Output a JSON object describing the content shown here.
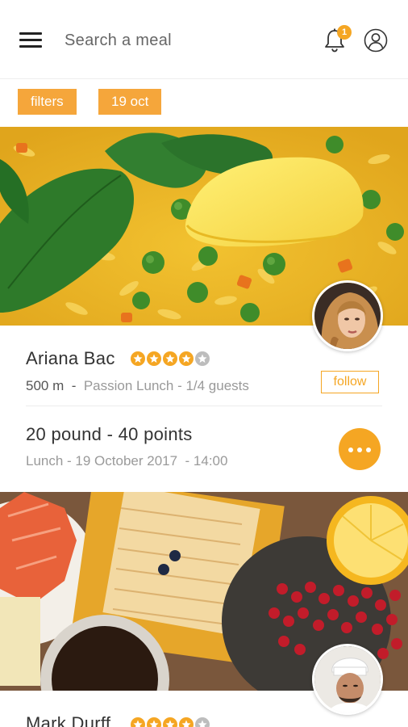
{
  "search": {
    "placeholder": "Search a meal"
  },
  "notifications": {
    "count": "1"
  },
  "filters": {
    "filters_label": "filters",
    "date_label": "19 oct"
  },
  "meals": [
    {
      "host": "Ariana Bac",
      "rating": 4,
      "rating_max": 5,
      "distance": "500 m",
      "separator": "-",
      "event": "Passion Lunch - 1/4 guests",
      "follow_label": "follow",
      "price": "20 pound - 40 points",
      "schedule": "Lunch - 19 October 2017",
      "time": "- 14:00"
    },
    {
      "host": "Mark Durff",
      "rating": 4,
      "rating_max": 5
    }
  ],
  "colors": {
    "accent": "#f5a623",
    "star_empty": "#bdbdbd"
  }
}
